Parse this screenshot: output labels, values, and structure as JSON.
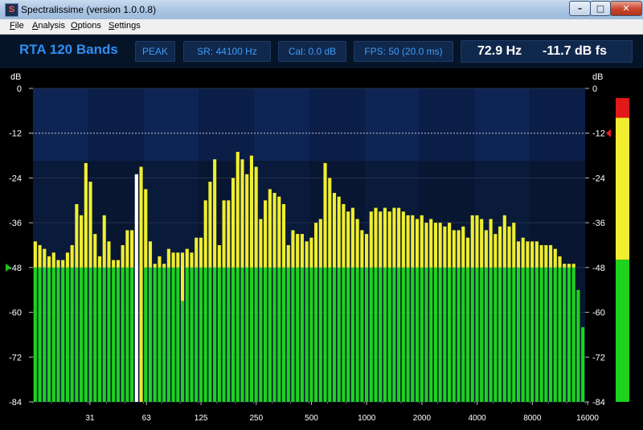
{
  "window": {
    "title": "Spectralissime (version 1.0.0.8)",
    "icon": "S",
    "minimize_label": "–",
    "maximize_label": "□",
    "close_label": "✕"
  },
  "menu": [
    {
      "label": "File",
      "underline": "F"
    },
    {
      "label": "Analysis",
      "underline": "A"
    },
    {
      "label": "Options",
      "underline": "O"
    },
    {
      "label": "Settings",
      "underline": "S"
    }
  ],
  "toolbar": {
    "mode_title": "RTA 120 Bands",
    "detector": "PEAK",
    "sample_rate": "SR: 44100 Hz",
    "calibration": "Cal:  0.0 dB",
    "fps": "FPS: 50   (20.0 ms)",
    "cursor_frequency": "72.9 Hz",
    "cursor_level": "-11.7 dB fs"
  },
  "colors": {
    "current_level": "#1ed21e",
    "peak_hold": "#f0ee2e",
    "cursor_bar": "#ffffff",
    "accent_text": "#2f8ef0",
    "meter_red": "#e11919",
    "meter_yellow": "#f0ee2e",
    "meter_green": "#1ed21e",
    "marker": "#18c818",
    "marker_top": "#e82020"
  },
  "chart_data": {
    "type": "bar",
    "title": "RTA 120 Bands",
    "ylabel_left": "dB",
    "ylabel_right": "dB",
    "ylim": [
      -84,
      0
    ],
    "y_ticks": [
      "0",
      "-12",
      "-24",
      "-36",
      "-48",
      "-60",
      "-72",
      "-84"
    ],
    "x_tick_labels": [
      "31",
      "63",
      "125",
      "250",
      "500",
      "1000",
      "2000",
      "4000",
      "8000",
      "16000"
    ],
    "x_scale": "log (1/12 octave bands)",
    "band_count": 120,
    "reference_line_db": -12,
    "cursor_band_index": 22,
    "series": [
      {
        "name": "peak hold",
        "values": [
          -41,
          -42,
          -43,
          -45,
          -44,
          -46,
          -46,
          -44,
          -42,
          -31,
          -34,
          -20,
          -25,
          -39,
          -45,
          -34,
          -41,
          -46,
          -46,
          -42,
          -38,
          -38,
          -23,
          -21,
          -27,
          -41,
          -47,
          -45,
          -47,
          -43,
          -44,
          -44,
          -44,
          -43,
          -44,
          -40,
          -40,
          -30,
          -25,
          -19,
          -42,
          -30,
          -30,
          -24,
          -17,
          -19,
          -23,
          -18,
          -21,
          -35,
          -30,
          -27,
          -28,
          -29,
          -31,
          -42,
          -38,
          -39,
          -39,
          -41,
          -40,
          -36,
          -35,
          -20,
          -24,
          -28,
          -29,
          -31,
          -33,
          -32,
          -35,
          -38,
          -39,
          -33,
          -32,
          -33,
          -32,
          -33,
          -32,
          -32,
          -33,
          -34,
          -34,
          -35,
          -34,
          -36,
          -35,
          -36,
          -36,
          -37,
          -36,
          -38,
          -38,
          -37,
          -40,
          -34,
          -34,
          -35,
          -38,
          -35,
          -39,
          -37,
          -34,
          -37,
          -36,
          -41,
          -40,
          -41,
          -41,
          -41,
          -42,
          -42,
          -42,
          -43,
          -45,
          -47,
          -47,
          -47,
          -54,
          -64
        ]
      },
      {
        "name": "current level",
        "values": [
          -48,
          -48,
          -48,
          -48,
          -48,
          -48,
          -48,
          -48,
          -48,
          -48,
          -48,
          -48,
          -48,
          -48,
          -48,
          -48,
          -48,
          -48,
          -48,
          -48,
          -48,
          -48,
          -48,
          -84,
          -48,
          -48,
          -48,
          -48,
          -48,
          -48,
          -48,
          -48,
          -57,
          -48,
          -48,
          -48,
          -48,
          -48,
          -48,
          -48,
          -48,
          -48,
          -48,
          -48,
          -48,
          -48,
          -48,
          -48,
          -48,
          -48,
          -48,
          -48,
          -48,
          -48,
          -48,
          -48,
          -48,
          -48,
          -48,
          -48,
          -48,
          -48,
          -48,
          -48,
          -48,
          -48,
          -48,
          -48,
          -48,
          -48,
          -48,
          -48,
          -48,
          -48,
          -48,
          -48,
          -48,
          -48,
          -48,
          -48,
          -48,
          -48,
          -48,
          -48,
          -48,
          -48,
          -48,
          -48,
          -48,
          -48,
          -48,
          -48,
          -48,
          -48,
          -48,
          -48,
          -48,
          -48,
          -48,
          -48,
          -48,
          -48,
          -48,
          -48,
          -48,
          -48,
          -48,
          -48,
          -48,
          -48,
          -48,
          -48,
          -48,
          -48,
          -48,
          -48,
          -48,
          -48,
          -54,
          -64
        ]
      }
    ],
    "level_meter": {
      "value_db": -11.7,
      "peak_hold_db": -7
    }
  }
}
